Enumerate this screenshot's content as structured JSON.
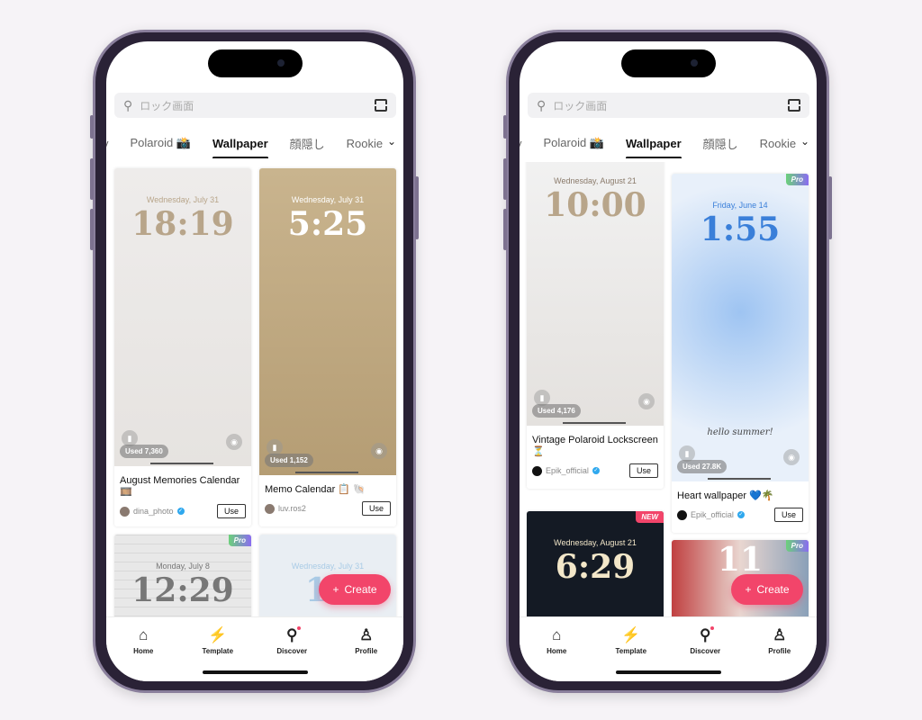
{
  "colors": {
    "accent": "#f2456a",
    "verified": "#2fa8ee",
    "pro_badge": "#8a6cf0",
    "new_badge": "#f2456a"
  },
  "phones": [
    {
      "search": {
        "placeholder": "ロック画面",
        "icon": "search-icon",
        "scan_icon": "scan-icon"
      },
      "tabs": [
        "y",
        "Polaroid 📸",
        "Wallpaper",
        "顔隠し",
        "Rookie"
      ],
      "active_tab": 2,
      "cards": [
        {
          "date": "Wednesday, July 31",
          "time": "18:19",
          "used": "Used 7,360",
          "title": "August Memories Calendar 🎞️",
          "author": "dina_photo",
          "verified": true,
          "use": "Use"
        },
        {
          "date": "Wednesday, July 31",
          "time": "5:25",
          "used": "Used 1,152",
          "title": "Memo Calendar 📋 🐚",
          "author": "luv.ros2",
          "verified": false,
          "use": "Use"
        },
        {
          "date": "Monday, July 8",
          "time": "12:29",
          "badge": "Pro"
        },
        {
          "date": "Wednesday, July 31",
          "time": "17"
        }
      ],
      "create": "Create",
      "nav": [
        "Home",
        "Template",
        "Discover",
        "Profile"
      ]
    },
    {
      "search": {
        "placeholder": "ロック画面",
        "icon": "search-icon",
        "scan_icon": "scan-icon"
      },
      "tabs": [
        "y",
        "Polaroid 📸",
        "Wallpaper",
        "顔隠し",
        "Rookie"
      ],
      "active_tab": 2,
      "cards": [
        {
          "date": "Wednesday, August 21",
          "time": "10:00",
          "used": "Used 4,176",
          "title": "Vintage Polaroid Lockscreen ⏳",
          "author": "Epik_official",
          "verified": true,
          "use": "Use"
        },
        {
          "date": "Friday, June 14",
          "time": "1:55",
          "caption": "hello summer!",
          "badge": "Pro",
          "used": "Used 27.8K",
          "title": "Heart wallpaper 💙🌴",
          "author": "Epik_official",
          "verified": true,
          "use": "Use"
        },
        {
          "date": "Wednesday, August 21",
          "time": "6:29",
          "badge": "NEW"
        },
        {
          "badge": "Pro",
          "time": "11"
        }
      ],
      "create": "Create",
      "nav": [
        "Home",
        "Template",
        "Discover",
        "Profile"
      ]
    }
  ]
}
